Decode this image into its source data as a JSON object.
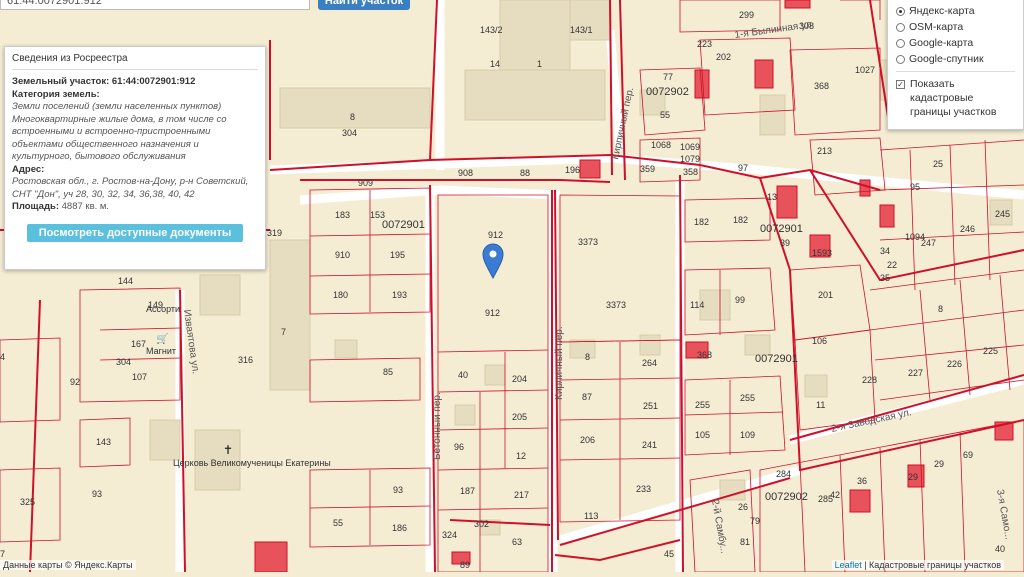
{
  "search": {
    "value": "61:44:0072901:912",
    "button": "Найти участок"
  },
  "info": {
    "title": "Сведения из Росреестра",
    "parcel_label": "Земельный участок:",
    "parcel_value": "61:44:0072901:912",
    "category_label": "Категория земель:",
    "category_value": "Земли поселений (земли населенных пунктов)",
    "use_value": "Многоквартирные жилые дома, в том числе со встроенными и встроенно-пристроенными объектами общественного назначения и культурного, бытового обслуживания",
    "address_label": "Адрес:",
    "address_value": "Ростовская обл., г. Ростов-на-Дону, р-н Советский, СНТ \"Дон\", уч 28, 30, 32, 34, 36,38, 40, 42",
    "area_label": "Площадь:",
    "area_value": "4887 кв. м.",
    "docs_button": "Посмотреть доступные документы"
  },
  "layers": {
    "options": [
      "Яндекс-карта",
      "OSM-карта",
      "Google-карта",
      "Google-спутник"
    ],
    "selected": "Яндекс-карта",
    "cadastral_label": "Показать кадастровые границы участков",
    "cadastral_checked": true
  },
  "streets": [
    "1-я Былинная ул.",
    "Кирпичный пер.",
    "Бетонный пер.",
    "Кирличный пер.",
    "Изваятова ул.",
    "2-я Заводская ул.",
    "2-й Самбу...",
    "3-я Само..."
  ],
  "quarters": [
    "0072901",
    "0072902"
  ],
  "poi": {
    "church": "Церковь Великомученицы Екатерины",
    "shop": "Магнит",
    "shop2": "Ассорти"
  },
  "attribution": {
    "left": "Данные карты © Яндекс.Карты",
    "leaflet": "Leaflet",
    "right": "Кадастровые границы участков"
  },
  "marker_parcel": "912",
  "colors": {
    "map_bg": "#f4ecd3",
    "building": "#e6dcbf",
    "border": "#d0102a",
    "red_fill": "#e8525a",
    "marker": "#3b7bd3",
    "button": "#5bc0de"
  }
}
